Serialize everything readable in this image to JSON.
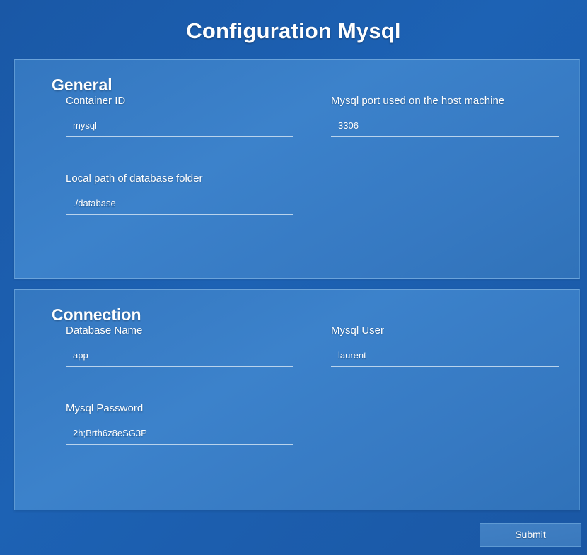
{
  "header": {
    "title": "Configuration Mysql"
  },
  "sections": [
    {
      "id": "general",
      "heading": "General",
      "fields": [
        {
          "label": "Container ID",
          "value": "mysql"
        },
        {
          "label": "Mysql port used on the host machine",
          "value": "3306"
        },
        {
          "label": "Local path of database folder",
          "value": "./database"
        }
      ]
    },
    {
      "id": "connection",
      "heading": "Connection",
      "fields": [
        {
          "label": "Database Name",
          "value": "app"
        },
        {
          "label": "Mysql User",
          "value": "laurent"
        },
        {
          "label": "Mysql Password",
          "value": "2h;Brth6z8eSG3P"
        }
      ]
    }
  ],
  "footer": {
    "submit_label": "Submit"
  },
  "colors": {
    "background": "#1d62b4",
    "panel": "#3c82cb",
    "panel_border": "#6ba3da",
    "text": "#ffffff",
    "input_underline": "#b9d3ec",
    "button_fill": "#4180c4",
    "button_border": "#5f9ad3"
  }
}
